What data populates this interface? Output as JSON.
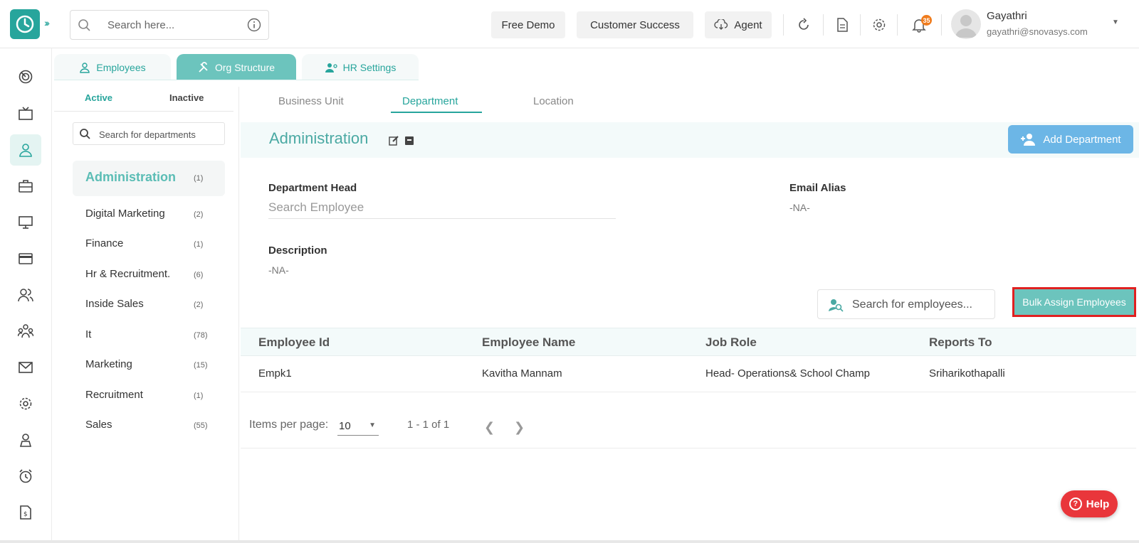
{
  "header": {
    "search_placeholder": "Search here...",
    "buttons": {
      "free_demo": "Free Demo",
      "customer_success": "Customer Success",
      "agent": "Agent"
    },
    "notification_count": "35",
    "user": {
      "name": "Gayathri",
      "email": "gayathri@snovasys.com"
    }
  },
  "colors": {
    "accent": "#27a59c",
    "tab_active": "#6cc4bd",
    "add_button": "#6cb6e6",
    "highlight_border": "#e02020",
    "help": "#e9363b"
  },
  "rail_icons": [
    "dashboard-icon",
    "tv-icon",
    "user-icon",
    "briefcase-icon",
    "monitor-icon",
    "card-icon",
    "people-icon",
    "org-icon",
    "mail-icon",
    "settings-icon",
    "badge-icon",
    "alarm-icon",
    "invoice-icon"
  ],
  "module_tabs": [
    {
      "label": "Employees"
    },
    {
      "label": "Org Structure"
    },
    {
      "label": "HR Settings"
    }
  ],
  "status_tabs": {
    "active": "Active",
    "inactive": "Inactive"
  },
  "dept_search_placeholder": "Search for departments",
  "departments": [
    {
      "name": "Administration",
      "count": "(1)"
    },
    {
      "name": "Digital Marketing",
      "count": "(2)"
    },
    {
      "name": "Finance",
      "count": "(1)"
    },
    {
      "name": "Hr & Recruitment.",
      "count": "(6)"
    },
    {
      "name": "Inside Sales",
      "count": "(2)"
    },
    {
      "name": "It",
      "count": "(78)"
    },
    {
      "name": "Marketing",
      "count": "(15)"
    },
    {
      "name": "Recruitment",
      "count": "(1)"
    },
    {
      "name": "Sales",
      "count": "(55)"
    }
  ],
  "sub_tabs": {
    "business_unit": "Business Unit",
    "department": "Department",
    "location": "Location"
  },
  "department": {
    "title": "Administration",
    "add_button": "Add Department",
    "head_label": "Department Head",
    "head_placeholder": "Search Employee",
    "email_label": "Email Alias",
    "email_value": "-NA-",
    "description_label": "Description",
    "description_value": "-NA-"
  },
  "employee_search_placeholder": "Search for employees...",
  "bulk_assign": "Bulk Assign Employees",
  "table": {
    "columns": [
      "Employee Id",
      "Employee Name",
      "Job Role",
      "Reports To"
    ],
    "rows": [
      [
        "Empk1",
        "Kavitha Mannam",
        "Head- Operations& School Champ",
        "Sriharikothapalli"
      ]
    ]
  },
  "pagination": {
    "items_per_page_label": "Items per page:",
    "items_per_page": "10",
    "range": "1 - 1 of 1"
  },
  "help": "Help"
}
